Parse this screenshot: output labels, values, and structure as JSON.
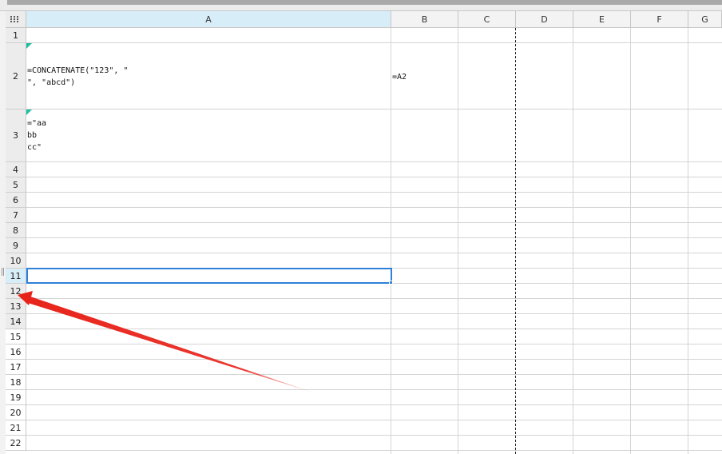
{
  "columns": [
    "A",
    "B",
    "C",
    "D",
    "E",
    "F",
    "G"
  ],
  "rows": [
    "1",
    "2",
    "3",
    "4",
    "5",
    "6",
    "7",
    "8",
    "9",
    "10",
    "11",
    "12",
    "13",
    "14",
    "15",
    "16",
    "17",
    "18",
    "19",
    "20",
    "21",
    "22"
  ],
  "cells": {
    "A2": "=CONCATENATE(\"123\", \"\n\", \"abcd\")",
    "B2": "=A2",
    "A3": "=\"aa\nbb\ncc\""
  },
  "selection": {
    "cell": "A11",
    "color": "#2f80d8"
  },
  "colors": {
    "active_header": "#d7eef9",
    "comment_marker": "#1fbfa0",
    "arrow": "#e8231a"
  },
  "icons": {
    "select_all": "grid-dots-icon",
    "annotation": "red-arrow-icon"
  }
}
